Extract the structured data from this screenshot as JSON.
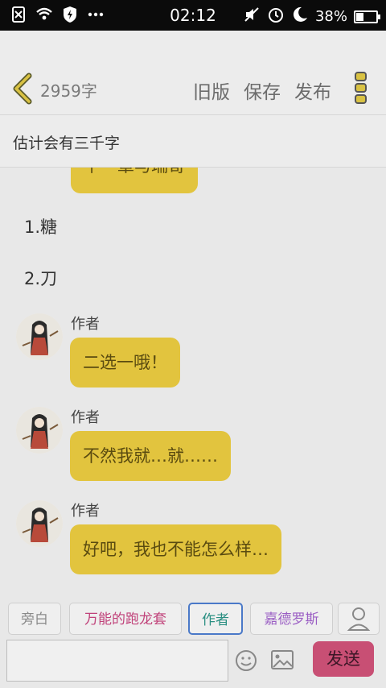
{
  "status_bar": {
    "time": "02:12",
    "battery": "38%",
    "battery_level": 0.38
  },
  "header": {
    "word_count": "2959字",
    "old_version": "旧版",
    "save": "保存",
    "publish": "发布"
  },
  "chapter_title": "估计会有三千字",
  "chat": {
    "cut_bubble_text": "下一章与瑞哥",
    "narration": [
      "1.糖",
      "2.刀"
    ],
    "messages": [
      {
        "author": "作者",
        "text": "二选一哦！"
      },
      {
        "author": "作者",
        "text": "不然我就…就……"
      },
      {
        "author": "作者",
        "text": "好吧，我也不能怎么样…"
      }
    ]
  },
  "roles": [
    {
      "label": "旁白",
      "color": "#8a8a8a",
      "selected": false
    },
    {
      "label": "万能的跑龙套",
      "color": "#c0427a",
      "selected": false
    },
    {
      "label": "作者",
      "color": "#2a8f82",
      "selected": true
    },
    {
      "label": "嘉德罗斯",
      "color": "#9b5fc4",
      "selected": false
    }
  ],
  "input": {
    "placeholder": "",
    "value": ""
  },
  "send_label": "发送",
  "icons": [
    "back-icon",
    "more-icon",
    "person-icon",
    "emoji-icon",
    "image-icon"
  ]
}
